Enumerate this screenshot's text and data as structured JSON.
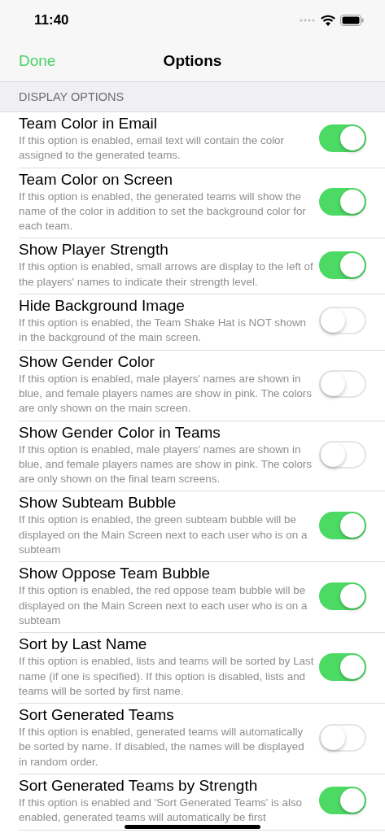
{
  "status_bar": {
    "time": "11:40"
  },
  "nav_bar": {
    "left_button": "Done",
    "title": "Options"
  },
  "section": {
    "header": "DISPLAY OPTIONS",
    "options": [
      {
        "title": "Team Color in Email",
        "description": "If this option is enabled, email text will contain the color assigned to the generated teams.",
        "on": true
      },
      {
        "title": "Team Color on Screen",
        "description": "If this option is enabled, the generated teams will show the name of the color in addition to set the background color for each team.",
        "on": true
      },
      {
        "title": "Show Player Strength",
        "description": "If this option is enabled, small arrows are display to the left of the players' names to indicate their strength level.",
        "on": true
      },
      {
        "title": "Hide Background Image",
        "description": "If this option is enabled, the Team Shake Hat is NOT shown in the background of the main screen.",
        "on": false
      },
      {
        "title": "Show Gender Color",
        "description": "If this option is enabled, male players' names are shown in blue, and female players names are show in pink.  The colors are only shown on the main screen.",
        "on": false
      },
      {
        "title": "Show Gender Color in Teams",
        "description": "If this option is enabled, male players' names are shown in blue, and female players names are show in pink.  The colors are only shown on the final team screens.",
        "on": false
      },
      {
        "title": "Show Subteam Bubble",
        "description": "If this option is enabled, the green subteam bubble will be displayed on the Main Screen next to each user who is on a subteam",
        "on": true
      },
      {
        "title": "Show Oppose Team Bubble",
        "description": "If this option is enabled, the red oppose team bubble will be displayed on the Main Screen next to each user who is on a subteam",
        "on": true
      },
      {
        "title": "Sort by Last Name",
        "description": "If this option is enabled, lists and teams will be sorted by Last name (if one is specified).  If this option is disabled, lists and teams will be sorted by first name.",
        "on": true
      },
      {
        "title": "Sort Generated Teams",
        "description": "If this option is enabled, generated teams will automatically be sorted by name.  If disabled, the names will be displayed in random order.",
        "on": false
      },
      {
        "title": "Sort Generated Teams by Strength",
        "description": "If this option is enabled and 'Sort Generated Teams' is also enabled, generated teams will automatically be first",
        "on": true
      }
    ]
  }
}
